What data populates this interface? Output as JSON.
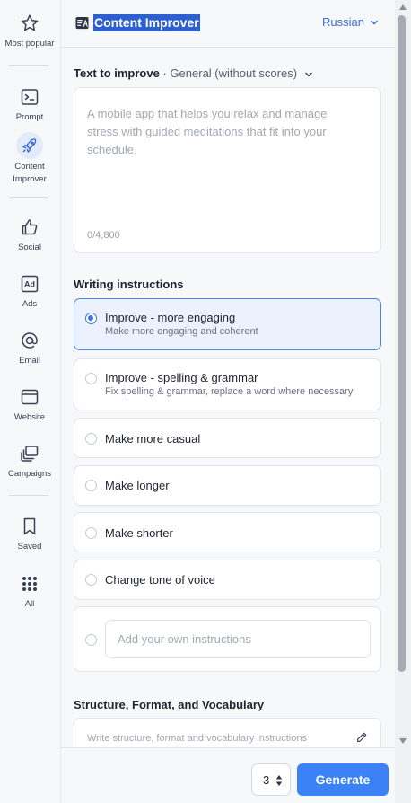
{
  "rail": {
    "most_popular": "Most popular",
    "prompt": "Prompt",
    "content_improver_l1": "Content",
    "content_improver_l2": "Improver",
    "social": "Social",
    "ads": "Ads",
    "email": "Email",
    "website": "Website",
    "campaigns": "Campaigns",
    "saved": "Saved",
    "all": "All"
  },
  "header": {
    "title": "Content Improver",
    "language": "Russian"
  },
  "text_to_improve": {
    "label": "Text to improve",
    "separator": "·",
    "mode": "General (without scores)",
    "placeholder": "A mobile app that helps you relax and manage stress with guided meditations that fit into your schedule.",
    "counter": "0/4,800"
  },
  "writing_instructions": {
    "label": "Writing instructions",
    "options": [
      {
        "title": "Improve - more engaging",
        "subtitle": "Make more engaging and coherent",
        "selected": true
      },
      {
        "title": "Improve - spelling & grammar",
        "subtitle": "Fix spelling & grammar, replace a word where necessary",
        "selected": false
      },
      {
        "title": "Make more casual",
        "selected": false
      },
      {
        "title": "Make longer",
        "selected": false
      },
      {
        "title": "Make shorter",
        "selected": false
      },
      {
        "title": "Change tone of voice",
        "selected": false
      }
    ],
    "own_placeholder": "Add your own instructions"
  },
  "structure": {
    "label": "Structure, Format, and Vocabulary",
    "placeholder": "Write structure, format and vocabulary instructions"
  },
  "footer": {
    "count": "3",
    "generate_label": "Generate"
  },
  "colors": {
    "accent": "#3b82f6",
    "selected_bg": "#ecf2fd",
    "title_highlight": "#2c5fcf",
    "link": "#3b6fd4"
  },
  "icons": [
    "star-icon",
    "prompt-icon",
    "rocket-icon",
    "thumbs-up-icon",
    "ad-icon",
    "at-sign-icon",
    "browser-window-icon",
    "layers-icon",
    "bookmark-icon",
    "grid-dots-icon",
    "content-improver-icon",
    "chevron-down-icon",
    "pencil-icon"
  ]
}
